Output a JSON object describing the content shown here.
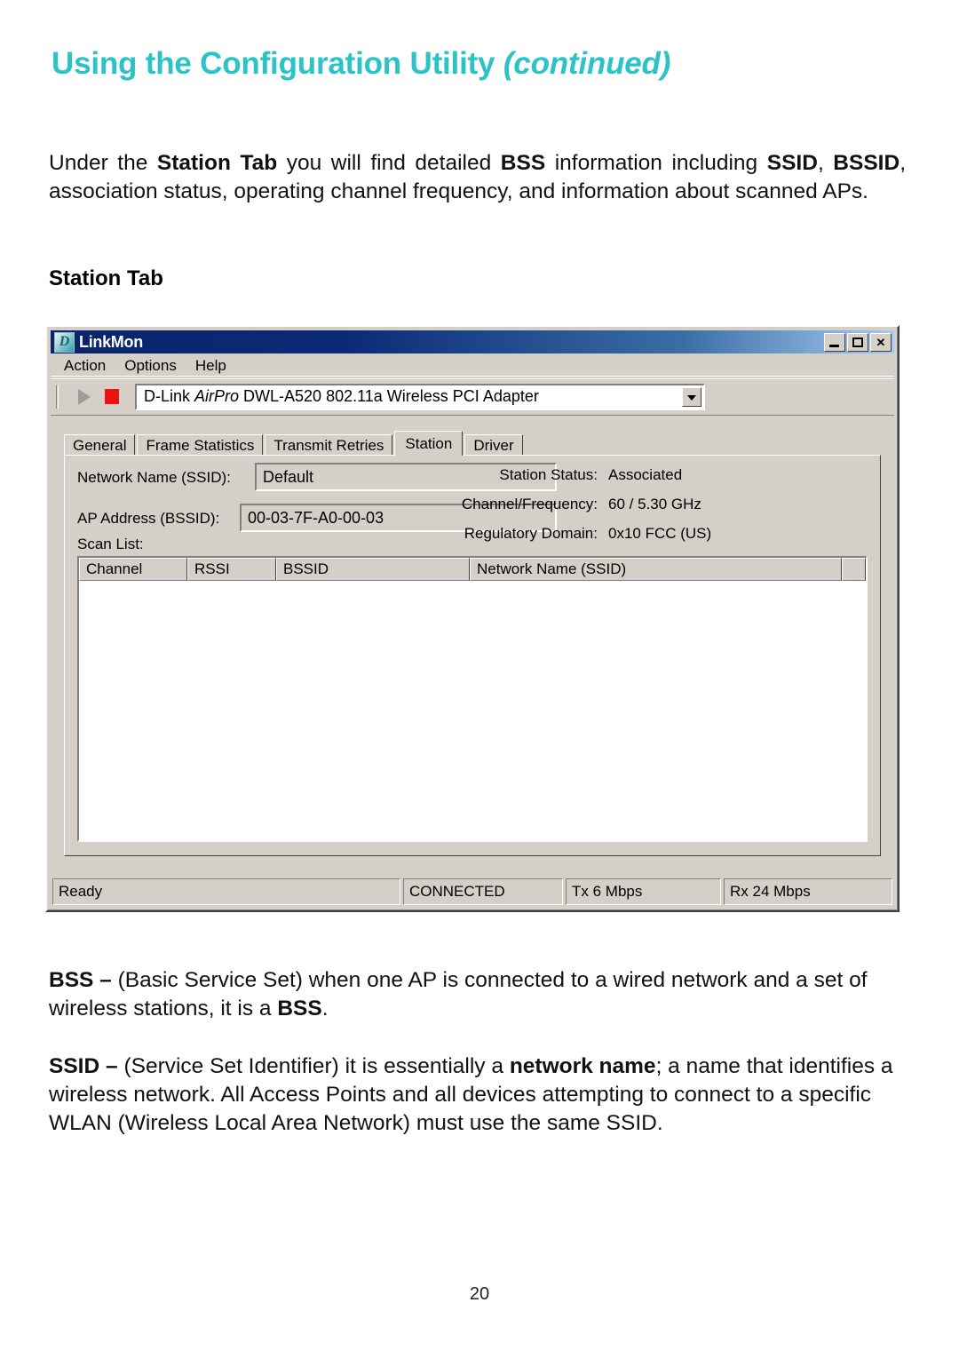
{
  "page": {
    "heading_main": "Using the Configuration Utility ",
    "heading_continued": "(continued)",
    "number": "20"
  },
  "intro": {
    "line1_a": "Under the ",
    "line1_b": "Station Tab",
    "line1_c": " you will find detailed ",
    "line1_d": "BSS",
    "line1_e": " information including ",
    "line1_f": "SSID",
    "line1_g": ", ",
    "line1_h": "BSSID",
    "line1_i": ", association status, operating channel frequency, and information about scanned APs."
  },
  "section_heading": "Station Tab",
  "app": {
    "title": "LinkMon",
    "icon": "dlink-logo-icon",
    "title_buttons": {
      "minimize": "minimize-button",
      "maximize": "maximize-button",
      "close": "✕"
    },
    "menu": [
      "Action",
      "Options",
      "Help"
    ],
    "toolbar": {
      "play_icon": "play-icon",
      "stop_icon": "stop-icon",
      "adapter_prefix": "D-Link ",
      "adapter_italic": "AirPro",
      "adapter_suffix": " DWL-A520 802.11a Wireless PCI Adapter",
      "dropdown_icon": "chevron-down-icon"
    },
    "tabs": [
      {
        "label": "General",
        "active": false
      },
      {
        "label": "Frame Statistics",
        "active": false
      },
      {
        "label": "Transmit Retries",
        "active": false
      },
      {
        "label": "Station",
        "active": true
      },
      {
        "label": "Driver",
        "active": false
      }
    ],
    "station": {
      "ssid_label": "Network Name (SSID):",
      "ssid_value": "Default",
      "bssid_label": "AP Address (BSSID):",
      "bssid_value": "00-03-7F-A0-00-03",
      "status_label": "Station Status:",
      "status_value": "Associated",
      "channel_label": "Channel/Frequency:",
      "channel_value": "60 / 5.30 GHz",
      "regdomain_label": "Regulatory Domain:",
      "regdomain_value": "0x10 FCC (US)",
      "scanlist_label": "Scan List:",
      "scan_columns": [
        "Channel",
        "RSSI",
        "BSSID",
        "Network Name (SSID)",
        ""
      ],
      "scan_rows": []
    },
    "status_bar": {
      "ready": "Ready",
      "connection": "CONNECTED",
      "tx": "Tx 6 Mbps",
      "rx": "Rx 24 Mbps"
    }
  },
  "glossary": {
    "bss_term": "BSS – ",
    "bss_text_a": "(Basic Service Set) when one AP is connected to a wired network and a set of wireless stations, it is a ",
    "bss_term2": "BSS",
    "bss_text_b": ".",
    "ssid_term": "SSID – ",
    "ssid_text_a": "(Service Set Identifier) it is essentially a ",
    "ssid_bold": "network name",
    "ssid_text_b": "; a name that identifies a wireless network.  All Access Points and all devices attempting to connect to a specific WLAN (Wireless Local Area Network) must use the same SSID."
  },
  "colors": {
    "heading": "#2BC3C6",
    "window_face": "#d4d0c8",
    "title_bar_start": "#0a246a",
    "stop_icon": "#ee1111"
  }
}
